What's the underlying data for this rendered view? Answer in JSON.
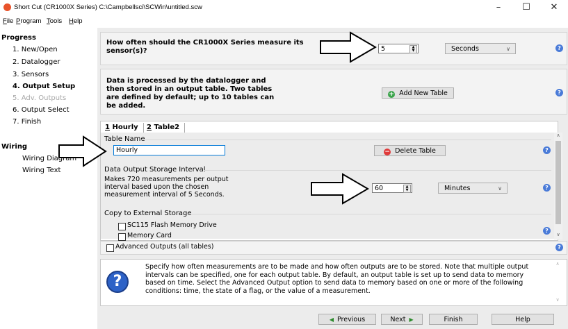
{
  "window": {
    "title": "Short Cut (CR1000X Series) C:\\Campbellsci\\SCWin\\untitled.scw",
    "minimize": "–",
    "maximize": "☐",
    "close": "✕"
  },
  "menu": {
    "items": [
      {
        "accel": "F",
        "rest": "ile"
      },
      {
        "accel": "P",
        "rest": "rogram"
      },
      {
        "accel": "T",
        "rest": "ools"
      },
      {
        "accel": "H",
        "rest": "elp"
      }
    ]
  },
  "sidebar": {
    "progress_heading": "Progress",
    "progress_items": [
      {
        "label": "1. New/Open",
        "state": "normal"
      },
      {
        "label": "2. Datalogger",
        "state": "normal"
      },
      {
        "label": "3. Sensors",
        "state": "normal"
      },
      {
        "label": "4. Output Setup",
        "state": "current"
      },
      {
        "label": "5. Adv. Outputs",
        "state": "disabled"
      },
      {
        "label": "6. Output Select",
        "state": "normal"
      },
      {
        "label": "7. Finish",
        "state": "normal"
      }
    ],
    "wiring_heading": "Wiring",
    "wiring_items": [
      {
        "label": "Wiring Diagram"
      },
      {
        "label": "Wiring Text"
      }
    ]
  },
  "measure": {
    "question_line1": "How often should the CR1000X Series measure its",
    "question_line2": "sensor(s)?",
    "interval_value": "5",
    "unit": "Seconds"
  },
  "tables_info": {
    "line1": "Data is processed by the datalogger and",
    "line2": "then stored in an output table. Two tables",
    "line3": "are defined by default; up to 10 tables can",
    "line4": "be added.",
    "add_button": "Add New Table"
  },
  "tabs": [
    {
      "accel": "1",
      "rest": " Hourly"
    },
    {
      "accel": "2",
      "rest": " Table2"
    }
  ],
  "table_name": {
    "label": "Table Name",
    "value": "Hourly",
    "delete_button": "Delete Table"
  },
  "storage_interval": {
    "label": "Data Output Storage Interval",
    "desc_line1": "Makes 720 measurements per output",
    "desc_line2": "interval based upon the chosen",
    "desc_line3": "measurement interval of 5 Seconds.",
    "value": "60",
    "unit": "Minutes"
  },
  "external_storage": {
    "label": "Copy to External Storage",
    "option1": "SC115 Flash Memory Drive",
    "option2": "Memory Card"
  },
  "advanced_outputs": {
    "label": "Advanced Outputs (all tables)",
    "checked": false
  },
  "help_text": {
    "line1": "Specify how often measurements are to be made and how often outputs are to be stored. Note that multiple output",
    "line2": "intervals can be specified, one for each output table. By default, an output table is set up to send data to memory",
    "line3": "based on time. Select the Advanced Output option to send data to memory based on one or more of the following",
    "line4": "conditions: time, the state of a flag, or the value of a measurement."
  },
  "footer": {
    "previous": "Previous",
    "next": "Next",
    "finish": "Finish",
    "help": "Help"
  },
  "colors": {
    "help_icon": "#4a7bd8",
    "add_icon": "#3aa34a",
    "delete_icon": "#e03a3a",
    "main_bg": "#ececec",
    "focus_border": "#0078d7"
  },
  "icons": {
    "app": "short-cut-app-icon",
    "help": "question-help-icon",
    "add": "plus-circle-icon",
    "delete": "minus-circle-icon",
    "arrow": "right-outline-arrow"
  }
}
